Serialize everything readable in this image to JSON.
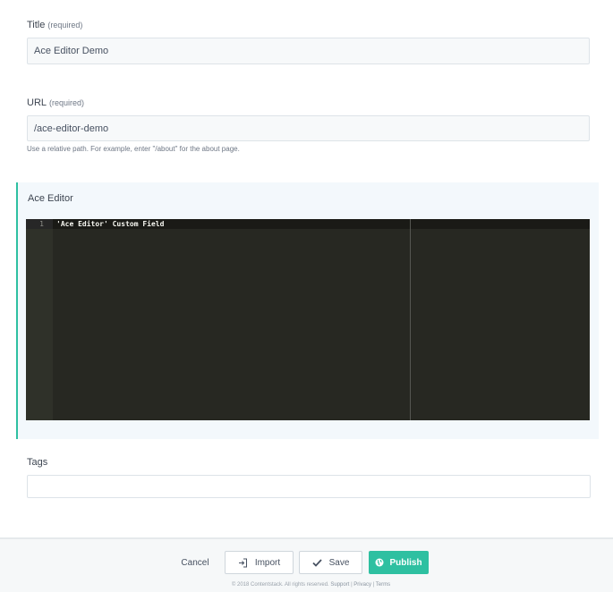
{
  "title_field": {
    "label": "Title",
    "required": "(required)",
    "value": "Ace Editor Demo"
  },
  "url_field": {
    "label": "URL",
    "required": "(required)",
    "value": "/ace-editor-demo",
    "help": "Use a relative path. For example, enter \"/about\" for the about page."
  },
  "ace_editor": {
    "label": "Ace Editor",
    "line_number": "1",
    "code_line": "'Ace Editor' Custom Field"
  },
  "tags_field": {
    "label": "Tags",
    "value": ""
  },
  "footer": {
    "cancel_label": "Cancel",
    "import_label": "Import",
    "save_label": "Save",
    "publish_label": "Publish",
    "copyright": "© 2018 Contentstack. All rights reserved.",
    "support_link": "Support",
    "privacy_link": "Privacy",
    "terms_link": "Terms",
    "separator": "|"
  },
  "colors": {
    "accent": "#2ec0a1",
    "editor_bg": "#272822"
  },
  "icons": {
    "import": "import-icon",
    "save": "checkmark-icon",
    "publish": "globe-icon"
  }
}
